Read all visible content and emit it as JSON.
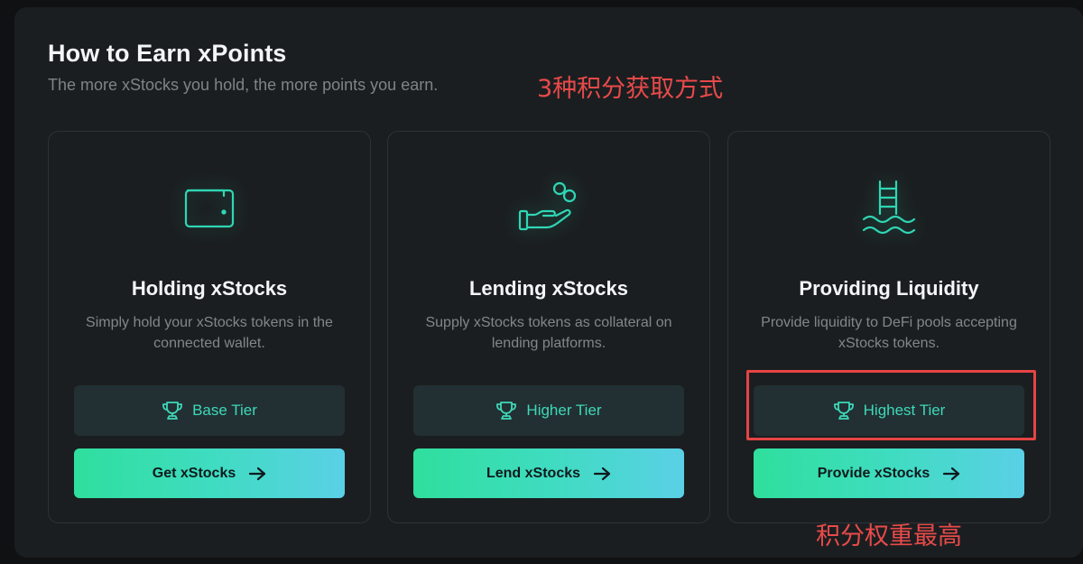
{
  "header": {
    "title": "How to Earn xPoints",
    "subtitle": "The more xStocks you hold, the more points you earn."
  },
  "annotations": {
    "top": "3种积分获取方式",
    "bottom": "积分权重最高"
  },
  "cards": [
    {
      "icon": "wallet-icon",
      "title": "Holding xStocks",
      "description": "Simply hold your xStocks tokens in the connected wallet.",
      "tier_label": "Base Tier",
      "cta_label": "Get xStocks"
    },
    {
      "icon": "hand-coins-icon",
      "title": "Lending xStocks",
      "description": "Supply xStocks tokens as collateral on lending platforms.",
      "tier_label": "Higher Tier",
      "cta_label": "Lend xStocks"
    },
    {
      "icon": "pool-ladder-icon",
      "title": "Providing Liquidity",
      "description": "Provide liquidity to DeFi pools accepting xStocks tokens.",
      "tier_label": "Highest Tier",
      "cta_label": "Provide xStocks"
    }
  ],
  "colors": {
    "accent": "#3ed8b8",
    "annotation": "#e54444",
    "background": "#1b1e20"
  }
}
